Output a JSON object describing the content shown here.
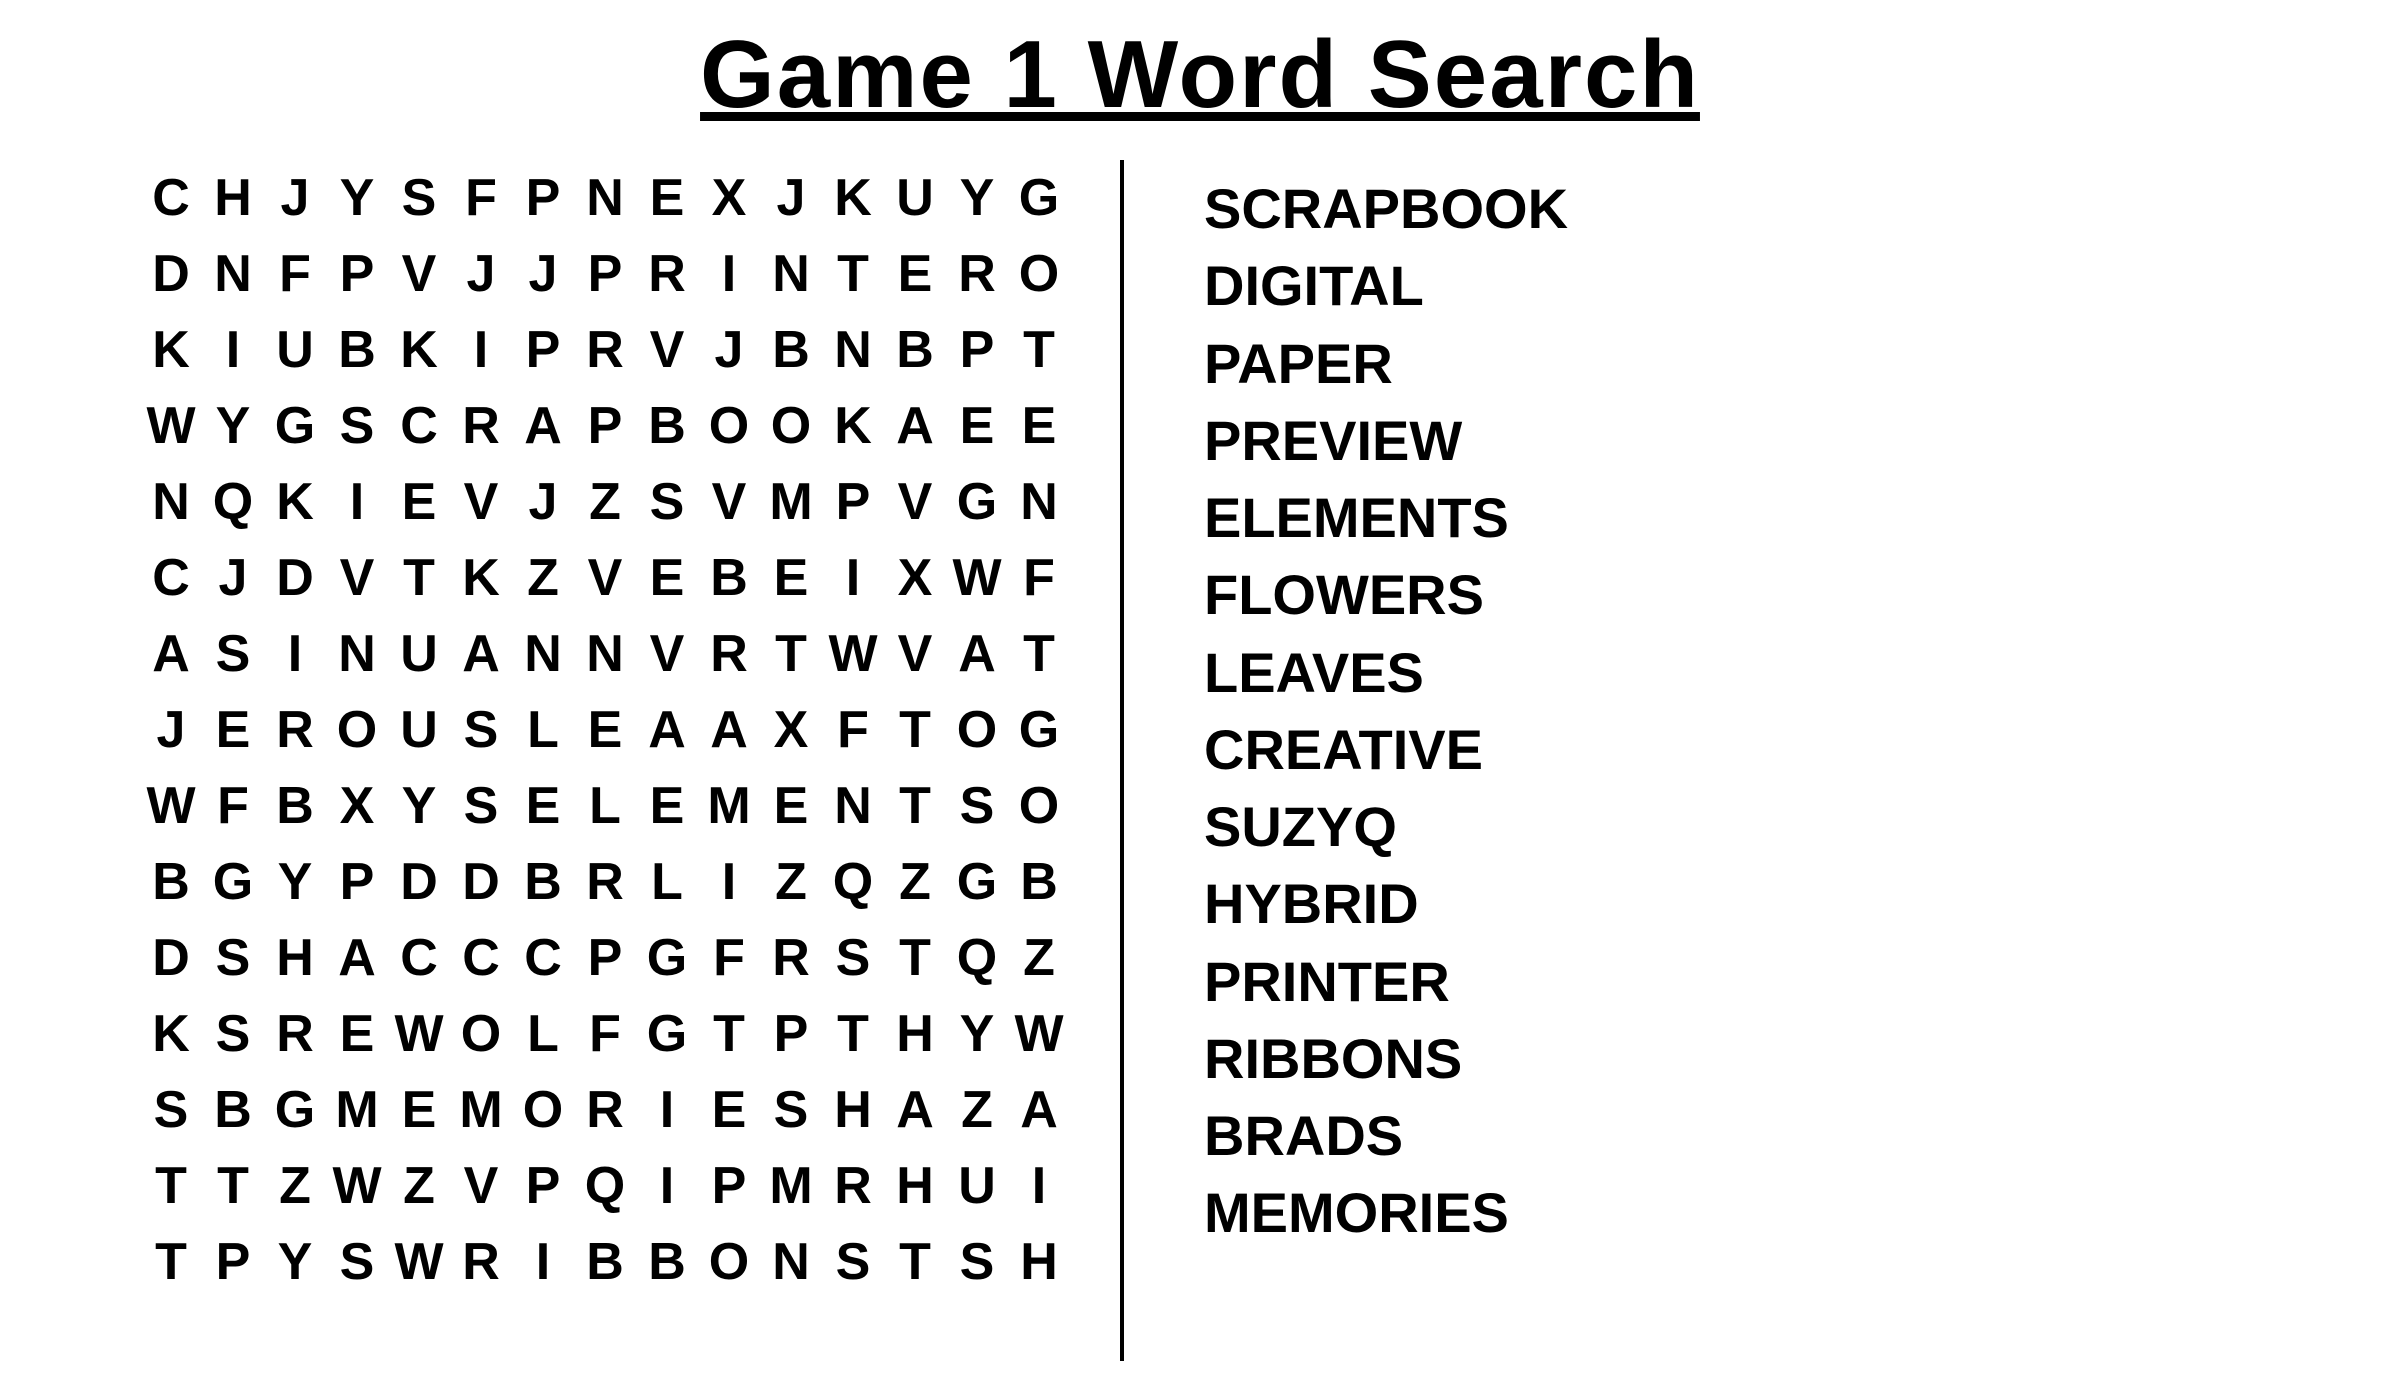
{
  "title": "Game 1 Word Search",
  "grid": [
    [
      "C",
      "H",
      "J",
      "Y",
      "S",
      "F",
      "P",
      "N",
      "E",
      "X",
      "J",
      "K",
      "U",
      "Y",
      "G"
    ],
    [
      "D",
      "N",
      "F",
      "P",
      "V",
      "J",
      "J",
      "P",
      "R",
      "I",
      "N",
      "T",
      "E",
      "R",
      "O"
    ],
    [
      "K",
      "I",
      "U",
      "B",
      "K",
      "I",
      "P",
      "R",
      "V",
      "J",
      "B",
      "N",
      "B",
      "P",
      "T"
    ],
    [
      "W",
      "Y",
      "G",
      "S",
      "C",
      "R",
      "A",
      "P",
      "B",
      "O",
      "O",
      "K",
      "A",
      "E",
      "E"
    ],
    [
      "N",
      "Q",
      "K",
      "I",
      "E",
      "V",
      "J",
      "Z",
      "S",
      "V",
      "M",
      "P",
      "V",
      "G",
      "N"
    ],
    [
      "C",
      "J",
      "D",
      "V",
      "T",
      "K",
      "Z",
      "V",
      "E",
      "B",
      "E",
      "I",
      "X",
      "W",
      "F"
    ],
    [
      "A",
      "S",
      "I",
      "N",
      "U",
      "A",
      "N",
      "N",
      "V",
      "R",
      "T",
      "W",
      "V",
      "A",
      "T"
    ],
    [
      "J",
      "E",
      "R",
      "O",
      "U",
      "S",
      "L",
      "E",
      "A",
      "A",
      "X",
      "F",
      "T",
      "O",
      "G"
    ],
    [
      "W",
      "F",
      "B",
      "X",
      "Y",
      "S",
      "E",
      "L",
      "E",
      "M",
      "E",
      "N",
      "T",
      "S",
      "O"
    ],
    [
      "B",
      "G",
      "Y",
      "P",
      "D",
      "D",
      "B",
      "R",
      "L",
      "I",
      "Z",
      "Q",
      "Z",
      "G",
      "B"
    ],
    [
      "D",
      "S",
      "H",
      "A",
      "C",
      "C",
      "C",
      "P",
      "G",
      "F",
      "R",
      "S",
      "T",
      "Q",
      "Z"
    ],
    [
      "K",
      "S",
      "R",
      "E",
      "W",
      "O",
      "L",
      "F",
      "G",
      "T",
      "P",
      "T",
      "H",
      "Y",
      "W"
    ],
    [
      "S",
      "B",
      "G",
      "M",
      "E",
      "M",
      "O",
      "R",
      "I",
      "E",
      "S",
      "H",
      "A",
      "Z",
      "A"
    ],
    [
      "T",
      "T",
      "Z",
      "W",
      "Z",
      "V",
      "P",
      "Q",
      "I",
      "P",
      "M",
      "R",
      "H",
      "U",
      "I"
    ],
    [
      "T",
      "P",
      "Y",
      "S",
      "W",
      "R",
      "I",
      "B",
      "B",
      "O",
      "N",
      "S",
      "T",
      "S",
      "H"
    ]
  ],
  "words": [
    "SCRAPBOOK",
    "DIGITAL",
    "PAPER",
    "PREVIEW",
    "ELEMENTS",
    "FLOWERS",
    "LEAVES",
    "CREATIVE",
    "SUZYQ",
    "HYBRID",
    "PRINTER",
    "RIBBONS",
    "BRADS",
    "MEMORIES"
  ]
}
